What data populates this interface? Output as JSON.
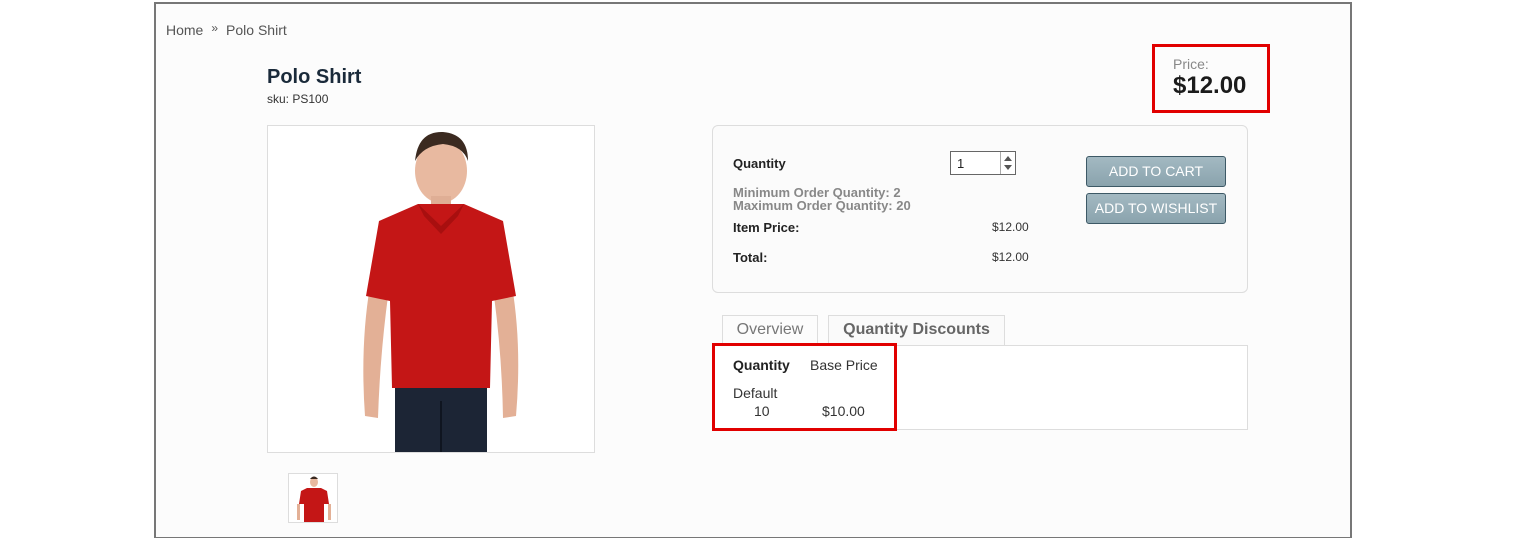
{
  "breadcrumb": {
    "items": [
      "Home",
      "Polo Shirt"
    ],
    "separator": "»"
  },
  "product": {
    "title": "Polo Shirt",
    "sku": "sku: PS100",
    "image": "product-photo-red-polo-shirt",
    "thumbnail": "product-thumbnail-red-polo-shirt"
  },
  "price": {
    "label": "Price:",
    "value": "$12.00"
  },
  "cart": {
    "quantity_label": "Quantity",
    "quantity_value": "1",
    "min_order": "Minimum Order Quantity: 2",
    "max_order": "Maximum Order Quantity: 20",
    "item_price_label": "Item Price:",
    "item_price_value": "$12.00",
    "total_label": "Total:",
    "total_value": "$12.00",
    "add_to_cart_label": "ADD TO CART",
    "add_to_wishlist_label": "ADD TO WISHLIST"
  },
  "tabs": [
    {
      "label": "Overview",
      "active": false
    },
    {
      "label": "Quantity Discounts",
      "active": true
    }
  ],
  "discounts": {
    "headers": [
      "Quantity",
      "Base Price"
    ],
    "group": "Default",
    "rows": [
      {
        "quantity": "10",
        "price": "$10.00"
      }
    ]
  },
  "colors": {
    "highlight": "#e10000",
    "button": "#8aa3ad",
    "title": "#1a2a3a"
  }
}
